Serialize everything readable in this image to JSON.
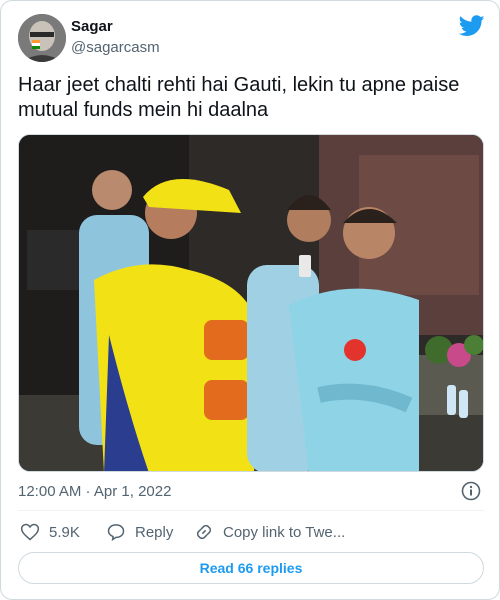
{
  "tweet": {
    "author_name": "Sagar",
    "author_handle": "@sagarcasm",
    "text": "Haar jeet chalti rehti hai Gauti, lekin tu apne paise mutual funds mein hi daalna",
    "timestamp": "12:00 AM · Apr 1, 2022"
  },
  "actions": {
    "like_count": "5.9K",
    "reply_label": "Reply",
    "copy_label": "Copy link to Twe..."
  },
  "read_replies_label": "Read 66 replies",
  "icons": {
    "brand": "twitter-bird-icon",
    "info": "info-icon",
    "like": "heart-icon",
    "reply": "speech-bubble-icon",
    "copy": "link-icon"
  },
  "colors": {
    "accent": "#1d9bf0",
    "text": "#0f1419",
    "secondary": "#536471",
    "border": "#cfd9de"
  }
}
